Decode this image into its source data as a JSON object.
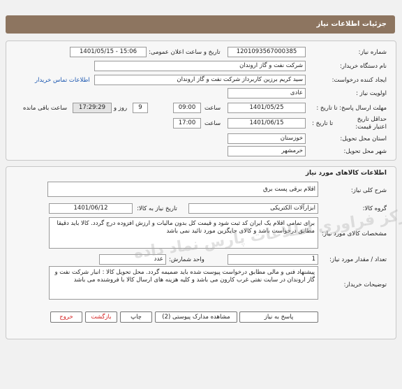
{
  "header": {
    "title": "جزئیات اطلاعات نیاز"
  },
  "need_info": {
    "need_number_label": "شماره نیاز:",
    "need_number": "1201093567000385",
    "announce_label": "تاریخ و ساعت اعلان عمومی:",
    "announce_value": "1401/05/15 - 15:06",
    "buyer_org_label": "نام دستگاه خریدار:",
    "buyer_org": "شرکت نفت و گاز اروندان",
    "requester_label": "ایجاد کننده درخواست:",
    "requester": "سید کریم برزین کاربرداز شرکت نفت و گاز اروندان",
    "contact_link": "اطلاعات تماس خریدار",
    "priority_label": "اولویت نیاز :",
    "priority": "عادی",
    "reply_deadline_label": "مهلت ارسال پاسخ: تا تاریخ :",
    "reply_date": "1401/05/25",
    "time_label": "ساعت",
    "reply_time": "09:00",
    "days_value": "9",
    "days_label": "روز و",
    "remaining_time": "17:29:29",
    "remaining_label": "ساعت باقی مانده",
    "validity_label": "حداقل تاریخ اعتبار قیمت:",
    "validity_until_label": "تا تاریخ :",
    "validity_date": "1401/06/15",
    "validity_time": "17:00",
    "province_label": "استان محل تحویل:",
    "province": "خوزستان",
    "city_label": "شهر محل تحویل:",
    "city": "خرمشهر"
  },
  "goods": {
    "title": "اطلاعات کالاهای مورد نیاز",
    "summary_label": "شرح کلی نیاز:",
    "summary": "اقلام برقی پست برق",
    "group_label": "گروه کالا:",
    "group": "ابزارآلات الکتریکی",
    "need_date_label": "تاریخ نیاز به کالا:",
    "need_date": "1401/06/12",
    "specs_label": "مشخصات کالای مورد نیاز:",
    "specs": "برای تمامی اقلام یک ایران کد ثبت شود و قیمت کل بدون مالیات و ارزش افزوده درج گردد. کالا باید دقیقا مطابق درخواست باشد و کالای جایگزین مورد تائید نمی باشد",
    "qty_label": "تعداد / مقدار مورد نیاز:",
    "qty": "1",
    "unit_label": "واحد شمارش:",
    "unit": "عدد",
    "buyer_notes_label": "توضیحات خریدار:",
    "buyer_notes": "پیشنهاد فنی و مالی مطابق درخواست پیوست شده باید ضمیمه گردد. محل تحویل کالا : انبار شرکت نفت و گاز اروندان در سایت نفتی غرب کارون می باشد و کلیه هزینه های ارسال کالا با فروشنده می باشد"
  },
  "watermark": "مرکز فراوری اطلاعات پارس نماد داده",
  "buttons": {
    "reply": "پاسخ به نیاز",
    "attachments": "مشاهده مدارک پیوستی (2)",
    "print": "چاپ",
    "back": "بازگشت",
    "exit": "خروج"
  }
}
